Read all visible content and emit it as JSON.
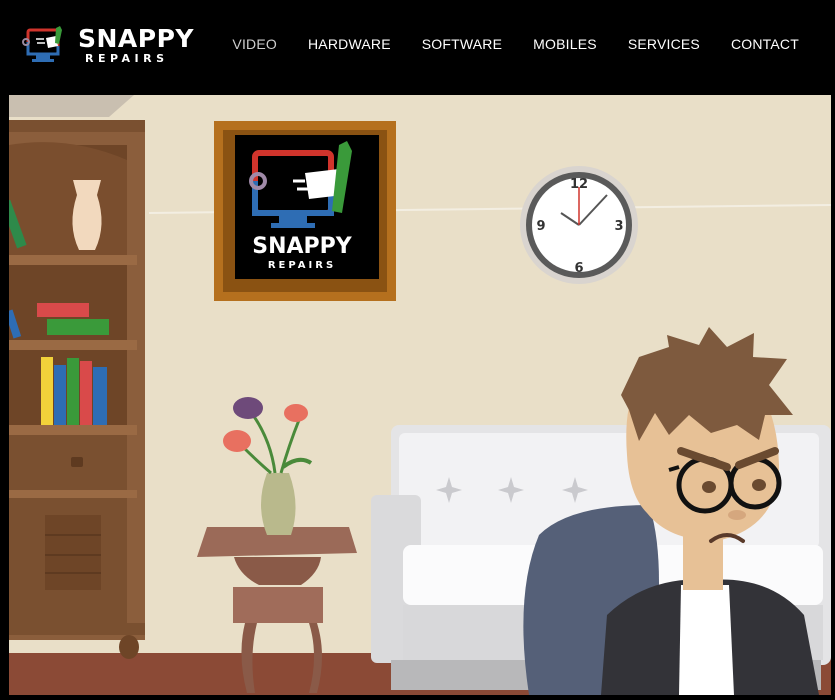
{
  "brand": {
    "name": "SNAPPY",
    "tagline": "REPAIRS"
  },
  "nav": [
    {
      "label": "VIDEO",
      "active": true
    },
    {
      "label": "HARDWARE",
      "active": false
    },
    {
      "label": "SOFTWARE",
      "active": false
    },
    {
      "label": "MOBILES",
      "active": false
    },
    {
      "label": "SERVICES",
      "active": false
    },
    {
      "label": "CONTACT",
      "active": false
    }
  ],
  "video": {
    "poster": {
      "frame": {
        "name": "SNAPPY",
        "tagline": "REPAIRS"
      },
      "clock": {
        "n12": "12",
        "n3": "3",
        "n6": "6",
        "n9": "9"
      }
    }
  },
  "colors": {
    "header_bg": "#000000",
    "wall": "#E9DFC8",
    "floor": "#8B4A36",
    "brand_red": "#D0342C",
    "brand_blue": "#2E6DB4",
    "brand_green": "#3A9A3A"
  }
}
